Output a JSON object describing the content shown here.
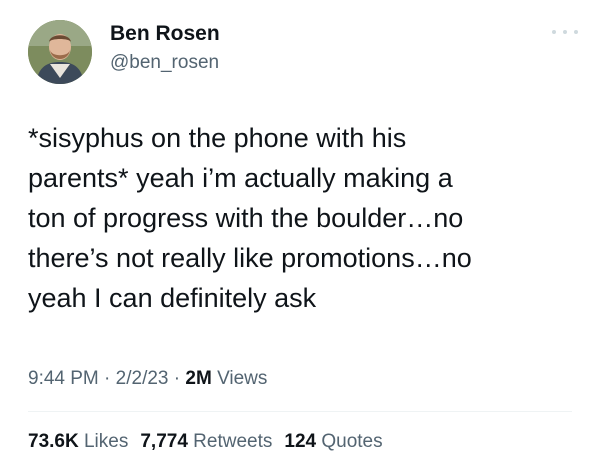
{
  "author": {
    "name": "Ben Rosen",
    "handle": "@ben_rosen"
  },
  "tweet": {
    "text": "*sisyphus on the phone with his\nparents* yeah i’m actually making a\nton of progress with the boulder…no\nthere’s not really like promotions…no\nyeah I can definitely ask"
  },
  "meta": {
    "time": "9:44 PM",
    "separator1": " · ",
    "date": "2/2/23",
    "separator2": " · ",
    "views_count": "2M",
    "views_label": "Views"
  },
  "stats": {
    "likes_count": "73.6K",
    "likes_label": "Likes",
    "retweets_count": "7,774",
    "retweets_label": "Retweets",
    "quotes_count": "124",
    "quotes_label": "Quotes"
  },
  "icons": {
    "more": "more-options-icon",
    "avatar": "avatar"
  },
  "colors": {
    "primary_text": "#0f1419",
    "secondary_text": "#536471",
    "divider": "#eff3f4",
    "background": "#ffffff"
  }
}
